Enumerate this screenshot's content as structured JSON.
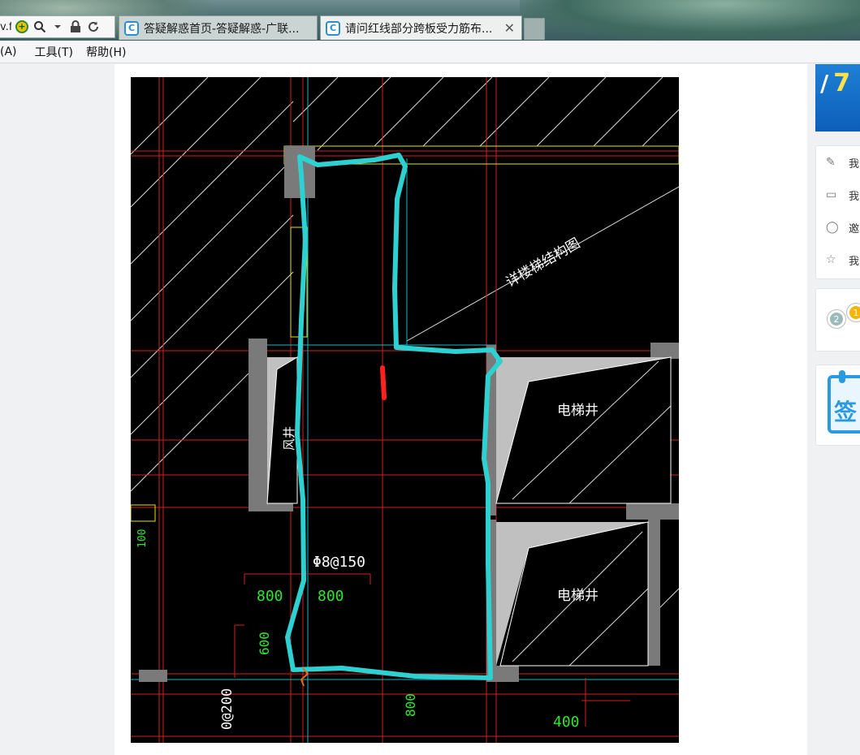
{
  "browser": {
    "address_fragment": "v.f",
    "tabs": [
      {
        "title": "答疑解惑首页-答疑解惑-广联...",
        "active": false
      },
      {
        "title": "请问红线部分跨板受力筋布...",
        "active": true
      }
    ],
    "close_glyph": "✕"
  },
  "menu": {
    "items": [
      "(A)",
      "工具(T)",
      "帮助(H)"
    ]
  },
  "drawing": {
    "label_stair": "详楼梯结构图",
    "label_elevator_1": "电梯井",
    "label_elevator_2": "电梯井",
    "label_shaft": "风井",
    "rebar": "Φ8@150",
    "dim_800_left": "800",
    "dim_800_right": "800",
    "dim_600": "600",
    "dim_bottom_800": "800",
    "dim_400": "400",
    "dim_left_edge": "100",
    "rebar_bottom": "0@200",
    "colors": {
      "background": "#000000",
      "grid_red": "#d62020",
      "highlight": "#2ed1d1",
      "wall": "#c0c0c0",
      "dimension": "#2ee62e"
    }
  },
  "sidebar": {
    "banner_text": "7",
    "quick_links": [
      {
        "icon": "question-edit-icon",
        "label": "我"
      },
      {
        "icon": "comment-icon",
        "label": "我"
      },
      {
        "icon": "user-icon",
        "label": "邀"
      },
      {
        "icon": "star-icon",
        "label": "我"
      }
    ],
    "medal_numbers": [
      "2",
      "1"
    ],
    "signin_char": "签"
  }
}
